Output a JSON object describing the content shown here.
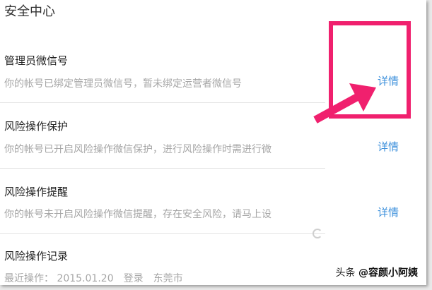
{
  "page": {
    "title": "安全中心"
  },
  "items": [
    {
      "title": "管理员微信号",
      "desc": "你的帐号已绑定管理员微信号，暂未绑定运营者微信号",
      "link": "详情"
    },
    {
      "title": "风险操作保护",
      "desc": "你的帐号已开启风险操作微信保护，进行风险操作时需进行微",
      "link": "详情"
    },
    {
      "title": "风险操作提醒",
      "desc": "你的帐号未开启风险操作微信提醒，存在安全风险，请马上设",
      "link": "详情"
    },
    {
      "title": "风险操作记录",
      "desc": "最近操作： 2015.01.20　登录　东莞市",
      "link": ""
    }
  ],
  "annotation": {
    "highlight_color": "#f0206e",
    "link_color": "#3b8fdb"
  },
  "watermark": {
    "prefix": "头条",
    "name": "@容颜小阿姨"
  }
}
